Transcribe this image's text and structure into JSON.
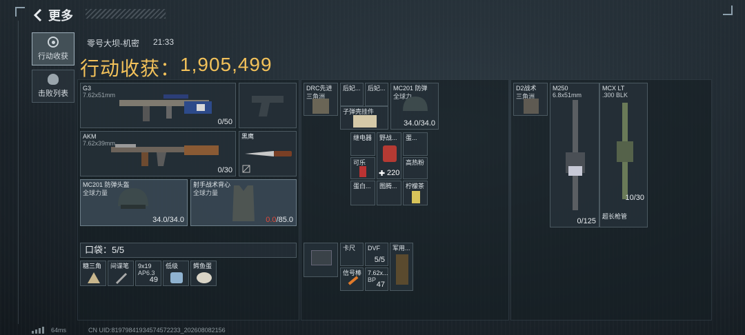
{
  "header": {
    "back_label": "更多"
  },
  "sidebar": {
    "tabs": [
      {
        "label": "行动收获"
      },
      {
        "label": "击败列表"
      }
    ]
  },
  "match": {
    "map": "零号大坝-机密",
    "time": "21:33"
  },
  "summary": {
    "title_prefix": "行动收获：",
    "value": "1,905,499"
  },
  "equipment": {
    "primary": {
      "name": "G3",
      "ammo_type": "7.62x51mm",
      "count": "0/50"
    },
    "secondary": {
      "name": "AKM",
      "ammo_type": "7.62x39mm",
      "count": "0/30"
    },
    "melee": {
      "name": "黑鹰"
    },
    "helmet": {
      "name": "MC201 防弹头盔",
      "brand": "全球力量",
      "durability": "34.0/34.0"
    },
    "armor": {
      "name": "射手战术背心",
      "brand": "全球力量",
      "durability_cur": "0.0",
      "durability_max": "/85.0"
    }
  },
  "pockets": {
    "label": "口袋：",
    "value": "5/5",
    "items": [
      {
        "name": "糖三角"
      },
      {
        "name": "间谍笔"
      },
      {
        "name": "9x19",
        "sub": "AP6.3",
        "count": "49"
      },
      {
        "name": "低级"
      },
      {
        "name": "鳄鱼蛋"
      }
    ]
  },
  "chest_rig": {
    "name": "DRC先进",
    "sub": "三角洲"
  },
  "backpack_top": [
    {
      "name": "后妃..."
    },
    {
      "name": "后妃..."
    },
    {
      "name": "子弹壳挂件"
    },
    {
      "name": "MC201 防弹",
      "sub": "全球力",
      "durability": "34.0/34.0"
    }
  ],
  "backpack_grid": [
    {
      "name": "继电器"
    },
    {
      "name": "野战..."
    },
    {
      "name": "蛋..."
    },
    {
      "name": "可乐"
    },
    {
      "name": "高热粉"
    },
    {
      "name": "蛋白..."
    },
    {
      "name": "图腾..."
    },
    {
      "name": "柠檬茶"
    }
  ],
  "backpack_plus": "220",
  "backpack_bottom": [
    {
      "name": "卡尺"
    },
    {
      "name": "DVF",
      "count": "5/5"
    },
    {
      "name": "军用..."
    },
    {
      "name": "信号棒"
    },
    {
      "name": "7.62x...",
      "sub": "BP",
      "count": "47"
    }
  ],
  "vest_slot": {
    "name": "D2战术",
    "sub": "三角洲"
  },
  "stash_weapons": [
    {
      "name": "M250",
      "ammo": "6.8x51mm",
      "count": "0/125"
    },
    {
      "name": "MCX LT",
      "ammo": ".300 BLK",
      "count": "10/30",
      "attachment": "超长枪管"
    }
  ],
  "footer": {
    "ping": "64ms",
    "uid": "CN UID:819798419345745722​33_202608082156"
  }
}
